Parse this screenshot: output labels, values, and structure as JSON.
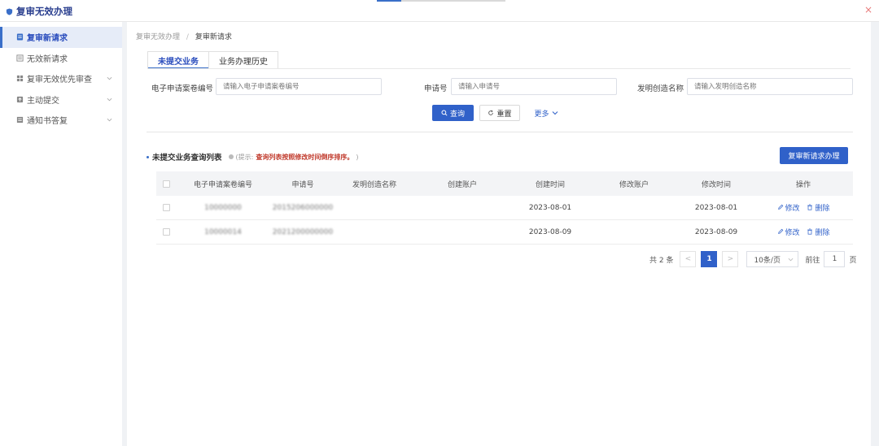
{
  "window": {
    "title": "复审无效办理",
    "close": "×"
  },
  "sidebar": {
    "items": [
      {
        "label": "复审新请求"
      },
      {
        "label": "无效新请求"
      },
      {
        "label": "复审无效优先审查"
      },
      {
        "label": "主动提交"
      },
      {
        "label": "通知书答复"
      }
    ]
  },
  "breadcrumb": {
    "parent": "复审无效办理",
    "separator": "/",
    "current": "复审新请求"
  },
  "tabs": [
    {
      "label": "未提交业务"
    },
    {
      "label": "业务办理历史"
    }
  ],
  "filters": {
    "case_no": {
      "label": "电子申请案卷编号",
      "placeholder": "请输入电子申请案卷编号"
    },
    "app_no": {
      "label": "申请号",
      "placeholder": "请输入申请号"
    },
    "invention": {
      "label": "发明创造名称",
      "placeholder": "请输入发明创造名称"
    }
  },
  "actions": {
    "search": "查询",
    "reset": "重置",
    "more": "更多"
  },
  "list": {
    "title": "未提交业务查询列表",
    "hint_prefix": "(提示:",
    "hint_red": "查询列表按照修改时间倒序排序。",
    "hint_suffix": ")",
    "new_button": "复审新请求办理"
  },
  "table": {
    "columns": [
      "电子申请案卷编号",
      "申请号",
      "发明创造名称",
      "创建账户",
      "创建时间",
      "修改账户",
      "修改时间",
      "操作"
    ],
    "rows": [
      {
        "case_no": "10000000",
        "app_no": "2015206000000",
        "invention": "",
        "creator": "",
        "created": "2023-08-01",
        "modifier": "",
        "modified": "2023-08-01",
        "edit": "修改",
        "delete": "删除"
      },
      {
        "case_no": "10000014",
        "app_no": "2021200000000",
        "invention": "",
        "creator": "",
        "created": "2023-08-09",
        "modifier": "",
        "modified": "2023-08-09",
        "edit": "修改",
        "delete": "删除"
      }
    ]
  },
  "pagination": {
    "total": "共 2 条",
    "prev": "<",
    "page": "1",
    "next": ">",
    "page_size": "10条/页",
    "goto_label": "前往",
    "goto_value": "1",
    "page_unit": "页"
  },
  "colors": {
    "primary": "#3061c9",
    "accent": "#3a6fc9",
    "warning": "#c0392b"
  }
}
